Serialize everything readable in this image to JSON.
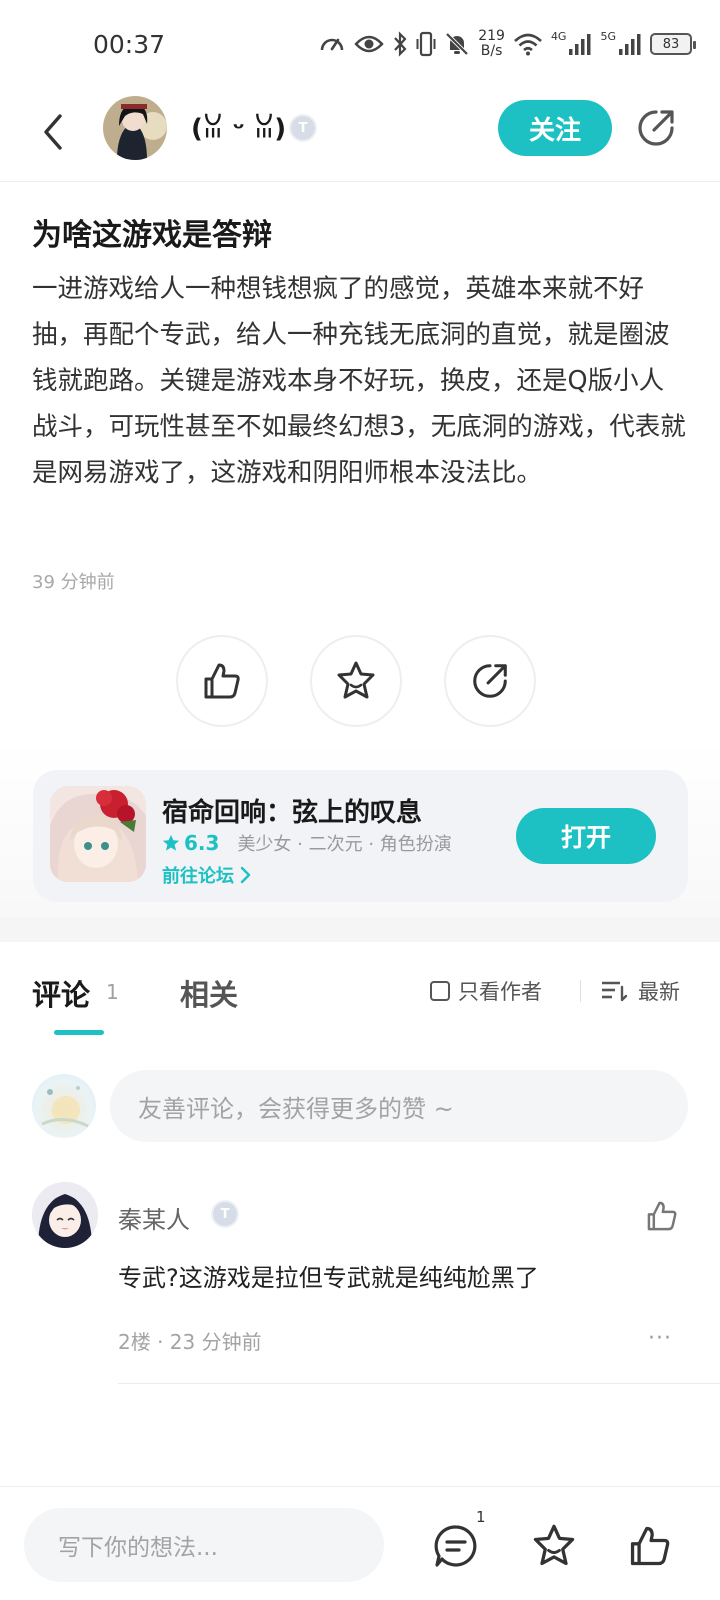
{
  "status_bar": {
    "time": "00:37",
    "net_speed_value": "219",
    "net_speed_unit": "B/s",
    "signal_1_label": "4G",
    "signal_2_label": "5G",
    "battery": "83",
    "icons": [
      "speed-icon",
      "eye-icon",
      "bluetooth-icon",
      "vibrate-icon",
      "mute-bell-icon",
      "wifi-icon",
      "signal-icon",
      "battery-icon"
    ]
  },
  "header": {
    "author_name": "(ꙨꙻꙫꙻꙨ)",
    "author_name_display": "(ꈍ ᵕ ꈍ)",
    "level_badge": "T",
    "follow_label": "关注"
  },
  "post": {
    "title": "为啥这游戏是答辩",
    "body": "一进游戏给人一种想钱想疯了的感觉，英雄本来就不好抽，再配个专武，给人一种充钱无底洞的直觉，就是圈波钱就跑路。关键是游戏本身不好玩，换皮，还是Q版小人战斗，可玩性甚至不如最终幻想3，无底洞的游戏，代表就是网易游戏了，这游戏和阴阳师根本没法比。",
    "time": "39 分钟前"
  },
  "game_card": {
    "title": "宿命回响：弦上的叹息",
    "rating": "6.3",
    "tags": "美少女 · 二次元 · 角色扮演",
    "forum_link": "前往论坛",
    "open_label": "打开"
  },
  "tabs": {
    "comment_label": "评论",
    "comment_count": "1",
    "related_label": "相关",
    "only_author_label": "只看作者",
    "sort_label": "最新"
  },
  "comment_input": {
    "placeholder": "友善评论，会获得更多的赞 ~"
  },
  "comments": [
    {
      "name": "秦某人",
      "level_badge": "T",
      "text": "专武?这游戏是拉但专武就是纯纯尬黑了",
      "meta": "2楼 · 23 分钟前",
      "more": "···"
    }
  ],
  "bottom_bar": {
    "placeholder": "写下你的想法...",
    "comment_badge": "1"
  },
  "colors": {
    "accent": "#1ec1c3",
    "text_primary": "#1a1a1a",
    "text_secondary": "#a3a3a3"
  }
}
